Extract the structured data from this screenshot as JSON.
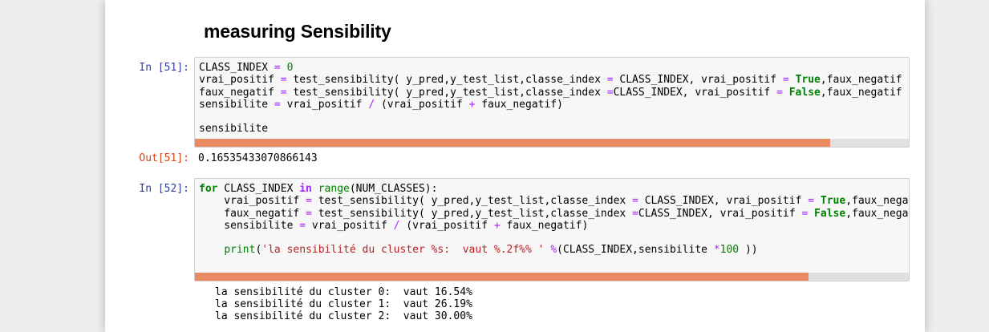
{
  "heading": "measuring Sensibility",
  "cells": [
    {
      "in_prompt": "In [51]:",
      "code_lines": [
        "CLASS_INDEX = 0",
        "vrai_positif = test_sensibility( y_pred,y_test_list,classe_index = CLASS_INDEX, vrai_positif = True,faux_negatif = False)",
        "faux_negatif = test_sensibility( y_pred,y_test_list,classe_index =CLASS_INDEX, vrai_positif = False,faux_negatif = True)",
        "sensibilite = vrai_positif / (vrai_positif + faux_negatif)",
        "",
        "sensibilite"
      ],
      "scroll_fraction": 0.89,
      "out_prompt": "Out[51]:",
      "output": "0.16535433070866143"
    },
    {
      "in_prompt": "In [52]:",
      "code_lines": [
        "for CLASS_INDEX in range(NUM_CLASSES):",
        "    vrai_positif = test_sensibility( y_pred,y_test_list,classe_index = CLASS_INDEX, vrai_positif = True,faux_negatif = False)",
        "    faux_negatif = test_sensibility( y_pred,y_test_list,classe_index =CLASS_INDEX, vrai_positif = False,faux_negatif = True)",
        "    sensibilite = vrai_positif / (vrai_positif + faux_negatif)",
        "",
        "    print('la sensibilité du cluster %s:  vaut %.2f%% ' %(CLASS_INDEX,sensibilite *100 ))"
      ],
      "scroll_fraction": 0.86,
      "output_lines": [
        "la sensibilité du cluster 0:  vaut 16.54%",
        "la sensibilité du cluster 1:  vaut 26.19%",
        "la sensibilité du cluster 2:  vaut 30.00%"
      ]
    }
  ]
}
